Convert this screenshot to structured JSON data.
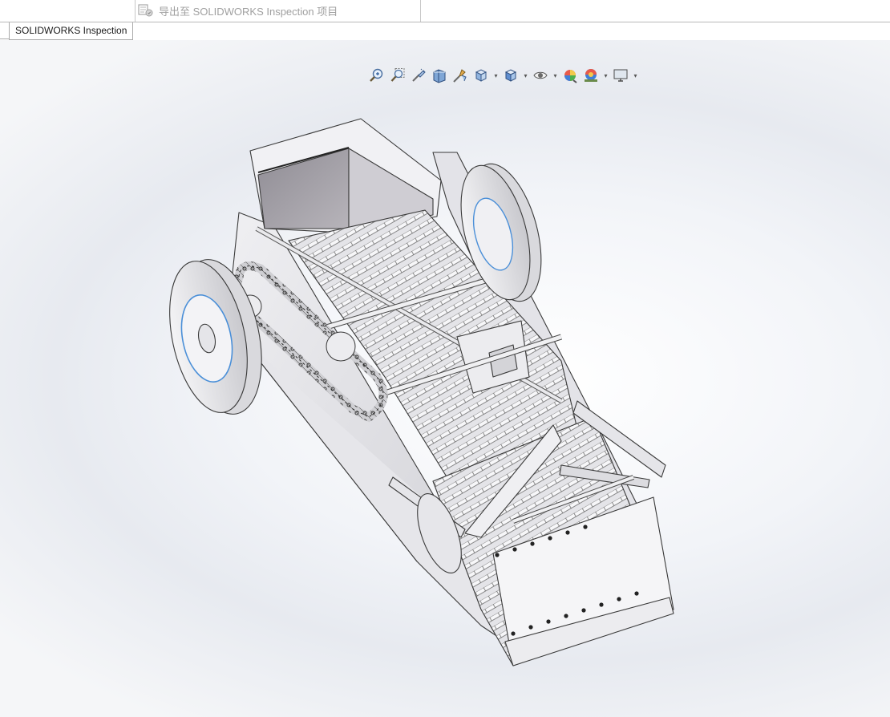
{
  "ribbon": {
    "export_label": "导出至 SOLIDWORKS Inspection 项目",
    "export_icon": "inspection-export-icon"
  },
  "tabs": [
    {
      "label": "SOLIDWORKS Inspection",
      "active": true
    }
  ],
  "heads_up_toolbar": [
    {
      "icon": "zoom-to-fit-icon"
    },
    {
      "icon": "zoom-to-area-icon"
    },
    {
      "icon": "previous-view-icon"
    },
    {
      "icon": "section-view-icon"
    },
    {
      "icon": "dynamic-annotation-views-icon"
    },
    {
      "icon": "view-orientation-icon",
      "dropdown": true
    },
    {
      "icon": "display-style-icon",
      "dropdown": true
    },
    {
      "icon": "hide-show-items-icon",
      "dropdown": true
    },
    {
      "icon": "edit-appearance-icon"
    },
    {
      "icon": "apply-scene-icon",
      "dropdown": true
    },
    {
      "icon": "view-settings-icon",
      "dropdown": true
    }
  ],
  "colors": {
    "viewport_bg": "#eef0f4",
    "model_fill": "#e9e9ec",
    "model_edge": "#3a3a3a",
    "accent_blue": "#2a6fdb"
  }
}
